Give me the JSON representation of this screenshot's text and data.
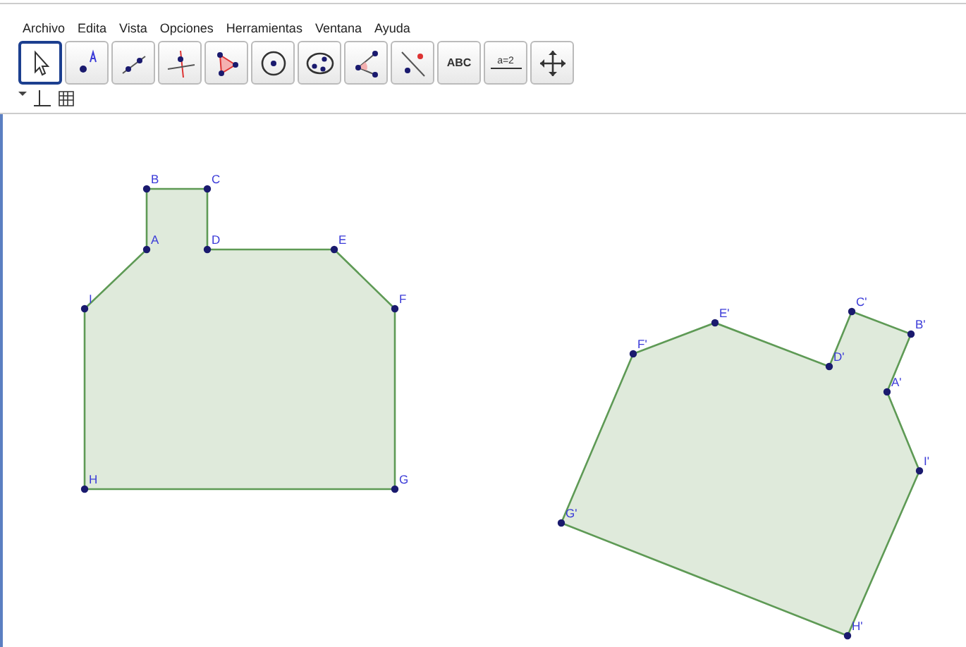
{
  "menu": [
    "Archivo",
    "Edita",
    "Vista",
    "Opciones",
    "Herramientas",
    "Ventana",
    "Ayuda"
  ],
  "toolbar": [
    {
      "kind": "move",
      "selected": true
    },
    {
      "kind": "point",
      "selected": false
    },
    {
      "kind": "line",
      "selected": false
    },
    {
      "kind": "perpendicular",
      "selected": false
    },
    {
      "kind": "polygon",
      "selected": false
    },
    {
      "kind": "circle",
      "selected": false
    },
    {
      "kind": "conic",
      "selected": false
    },
    {
      "kind": "angle",
      "selected": false
    },
    {
      "kind": "reflect",
      "selected": false
    },
    {
      "kind": "text",
      "label": "ABC",
      "selected": false
    },
    {
      "kind": "slider",
      "label": "a=2",
      "selected": false
    },
    {
      "kind": "pan",
      "selected": false
    }
  ],
  "style_bar": [
    {
      "kind": "axes"
    },
    {
      "kind": "grid"
    }
  ],
  "polygons": [
    {
      "points": [
        "A",
        "B",
        "C",
        "D",
        "E",
        "F",
        "G",
        "H",
        "I"
      ]
    },
    {
      "points": [
        "A'",
        "B'",
        "C'",
        "D'",
        "E'",
        "F'",
        "G'",
        "H'",
        "I'"
      ]
    }
  ]
}
